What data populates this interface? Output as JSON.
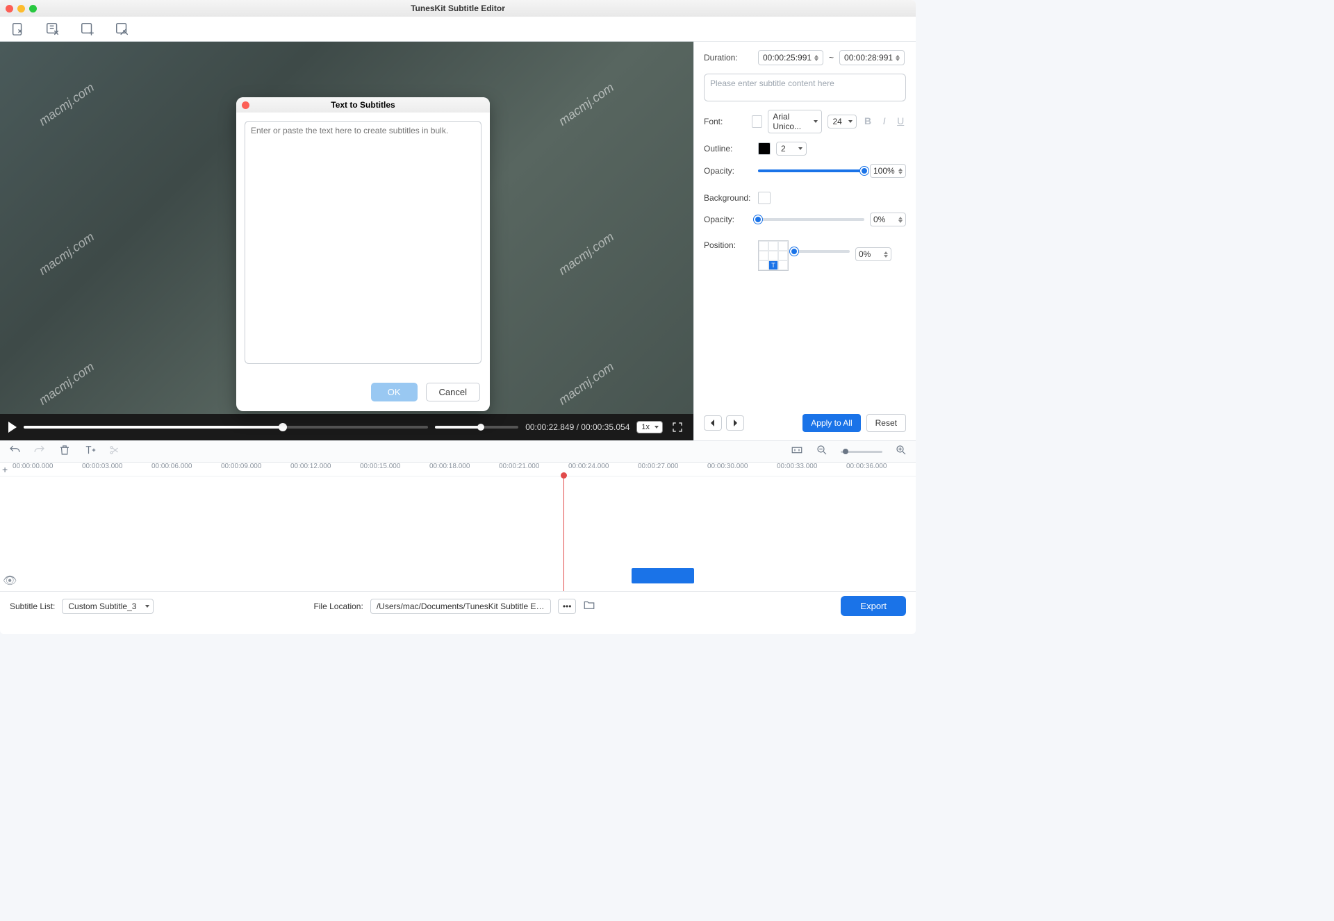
{
  "app": {
    "title": "TunesKit Subtitle Editor"
  },
  "toolbar_icons": [
    "import-icon",
    "text-to-subtitle-icon",
    "add-subtitle-icon",
    "edit-icon"
  ],
  "transport": {
    "current_time": "00:00:22.849",
    "total_time": "00:00:35.054",
    "speed": "1x"
  },
  "panel": {
    "duration_label": "Duration:",
    "start_time": "00:00:25:991",
    "time_tilde": "~",
    "end_time": "00:00:28:991",
    "content_placeholder": "Please enter subtitle content here",
    "font_label": "Font:",
    "font_value": "Arial Unico...",
    "font_size": "24",
    "outline_label": "Outline:",
    "outline_value": "2",
    "opacity_label": "Opacity:",
    "opacity_value": "100%",
    "background_label": "Background:",
    "bg_opacity_label": "Opacity:",
    "bg_opacity_value": "0%",
    "position_label": "Position:",
    "position_value": "0%",
    "apply_all": "Apply to All",
    "reset": "Reset"
  },
  "timeline": {
    "marks": [
      "00:00:00.000",
      "00:00:03.000",
      "00:00:06.000",
      "00:00:09.000",
      "00:00:12.000",
      "00:00:15.000",
      "00:00:18.000",
      "00:00:21.000",
      "00:00:24.000",
      "00:00:27.000",
      "00:00:30.000",
      "00:00:33.000",
      "00:00:36.000"
    ]
  },
  "footer": {
    "subtitle_list_label": "Subtitle List:",
    "subtitle_list_value": "Custom Subtitle_3",
    "file_location_label": "File Location:",
    "file_location_value": "/Users/mac/Documents/TunesKit Subtitle Editor/Expo",
    "dots": "•••",
    "export": "Export"
  },
  "modal": {
    "title": "Text to Subtitles",
    "placeholder": "Enter or paste the text here to create subtitles in bulk.",
    "ok": "OK",
    "cancel": "Cancel"
  },
  "watermark": "macmj.com"
}
